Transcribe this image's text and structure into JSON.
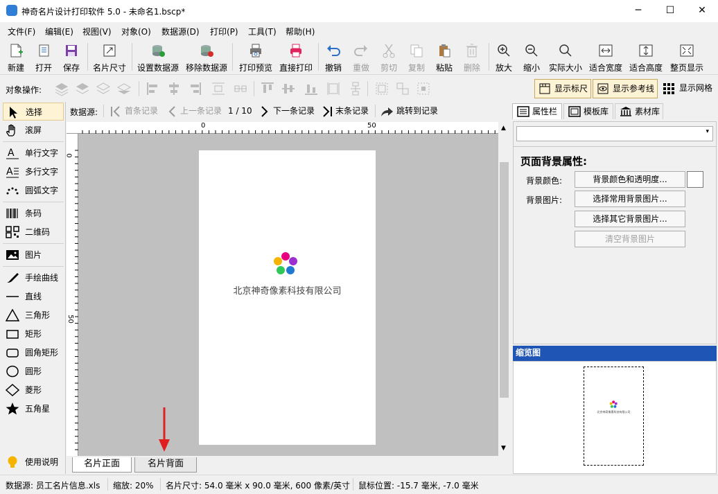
{
  "window": {
    "title": "神奇名片设计打印软件 5.0 - 未命名1.bscp*",
    "minimize": "─",
    "maximize": "☐",
    "close": "✕"
  },
  "menu": [
    "文件(F)",
    "编辑(E)",
    "视图(V)",
    "对象(O)",
    "数据源(D)",
    "打印(P)",
    "工具(T)",
    "帮助(H)"
  ],
  "toolbar": [
    {
      "label": "新建",
      "icon": "new-file-icon"
    },
    {
      "label": "打开",
      "icon": "open-icon"
    },
    {
      "label": "保存",
      "icon": "save-icon"
    },
    {
      "label": "名片尺寸",
      "icon": "card-size-icon"
    },
    {
      "label": "设置数据源",
      "icon": "database-add-icon"
    },
    {
      "label": "移除数据源",
      "icon": "database-remove-icon"
    },
    {
      "label": "打印预览",
      "icon": "print-preview-icon"
    },
    {
      "label": "直接打印",
      "icon": "printer-icon"
    },
    {
      "label": "撤销",
      "icon": "undo-icon"
    },
    {
      "label": "重做",
      "icon": "redo-icon",
      "disabled": true
    },
    {
      "label": "剪切",
      "icon": "scissors-icon",
      "disabled": true
    },
    {
      "label": "复制",
      "icon": "copy-icon",
      "disabled": true
    },
    {
      "label": "粘贴",
      "icon": "paste-icon"
    },
    {
      "label": "删除",
      "icon": "trash-icon",
      "disabled": true
    },
    {
      "label": "放大",
      "icon": "zoom-in-icon"
    },
    {
      "label": "缩小",
      "icon": "zoom-out-icon"
    },
    {
      "label": "实际大小",
      "icon": "actual-size-icon"
    },
    {
      "label": "适合宽度",
      "icon": "fit-width-icon"
    },
    {
      "label": "适合高度",
      "icon": "fit-height-icon"
    },
    {
      "label": "整页显示",
      "icon": "fit-page-icon"
    }
  ],
  "objbar": {
    "label": "对象操作:",
    "show_ruler": "显示标尺",
    "show_guides": "显示参考线",
    "show_grid": "显示网格"
  },
  "tools": [
    {
      "label": "选择",
      "icon": "pointer-icon",
      "selected": true
    },
    {
      "label": "滚屏",
      "icon": "hand-icon"
    },
    {
      "label": "单行文字",
      "icon": "single-line-text-icon"
    },
    {
      "label": "多行文字",
      "icon": "multi-line-text-icon"
    },
    {
      "label": "圆弧文字",
      "icon": "arc-text-icon"
    },
    {
      "label": "条码",
      "icon": "barcode-icon"
    },
    {
      "label": "二维码",
      "icon": "qrcode-icon"
    },
    {
      "label": "图片",
      "icon": "image-icon"
    },
    {
      "label": "手绘曲线",
      "icon": "pen-icon"
    },
    {
      "label": "直线",
      "icon": "line-icon"
    },
    {
      "label": "三角形",
      "icon": "triangle-icon"
    },
    {
      "label": "矩形",
      "icon": "rectangle-icon"
    },
    {
      "label": "圆角矩形",
      "icon": "rounded-rectangle-icon"
    },
    {
      "label": "圆形",
      "icon": "circle-icon"
    },
    {
      "label": "菱形",
      "icon": "diamond-icon"
    },
    {
      "label": "五角星",
      "icon": "star-icon"
    }
  ],
  "help": {
    "label": "使用说明"
  },
  "nav": {
    "label": "数据源:",
    "first": "首条记录",
    "prev": "上一条记录",
    "position": "1 / 10",
    "next": "下一条记录",
    "last": "末条记录",
    "jump": "跳转到记录"
  },
  "ruler": {
    "h0": "0",
    "h50": "50",
    "v0": "0",
    "v50": "50"
  },
  "card": {
    "company": "北京神奇像素科技有限公司"
  },
  "pages": {
    "front": "名片正面",
    "back": "名片背面"
  },
  "right": {
    "tabs": [
      "属性栏",
      "模板库",
      "素材库"
    ],
    "heading": "页面背景属性:",
    "bg_color_label": "背景颜色:",
    "bg_color_btn": "背景颜色和透明度...",
    "bg_image_label": "背景图片:",
    "pick_common": "选择常用背景图片...",
    "pick_other": "选择其它背景图片...",
    "clear_image": "清空背景图片",
    "thumb_title": "缩览图"
  },
  "status": {
    "datasource": "数据源: 员工名片信息.xls",
    "zoom": "缩放: 20%",
    "size": "名片尺寸: 54.0 毫米 x 90.0 毫米, 600 像素/英寸",
    "mouse": "鼠标位置: -15.7 毫米, -7.0 毫米"
  },
  "colors": {
    "accent": "#2a6fc9",
    "thumb_header": "#1f55b5",
    "arrow": "#e02020"
  }
}
